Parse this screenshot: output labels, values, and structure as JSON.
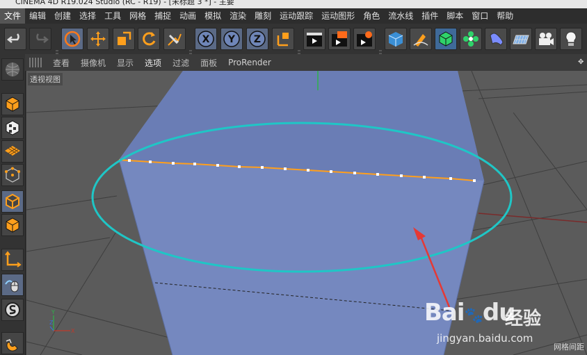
{
  "window": {
    "title": "CINEMA 4D R19.024 Studio (RC - R19) - [未标题 3 *] - 主要"
  },
  "menubar": {
    "items": [
      "文件",
      "编辑",
      "创建",
      "选择",
      "工具",
      "网格",
      "捕捉",
      "动画",
      "模拟",
      "渲染",
      "雕刻",
      "运动跟踪",
      "运动图形",
      "角色",
      "流水线",
      "插件",
      "脚本",
      "窗口",
      "帮助"
    ]
  },
  "toolbar": {
    "icons": [
      "undo-icon",
      "redo-icon",
      "live-selection-icon",
      "move-icon",
      "scale-icon",
      "rotate-icon",
      "recent-tools-icon",
      "x-axis-icon",
      "y-axis-icon",
      "z-axis-icon",
      "coordinate-system-icon",
      "render-view-icon",
      "render-picture-viewer-icon",
      "render-settings-icon",
      "cube-icon",
      "pen-icon",
      "subdivision-surface-icon",
      "cloner-icon",
      "deformer-icon",
      "floor-icon",
      "camera-icon",
      "light-icon"
    ],
    "axis_labels": {
      "x": "X",
      "y": "Y",
      "z": "Z"
    }
  },
  "viewport_menu": {
    "items": [
      "查看",
      "摄像机",
      "显示",
      "选项",
      "过滤",
      "面板",
      "ProRender"
    ]
  },
  "viewport": {
    "label": "透视视图",
    "grid_label": "网格间距",
    "axis": {
      "y": "Y",
      "z": "Z",
      "x": "X"
    }
  },
  "left_toolbar": {
    "icons": [
      "make-editable-icon",
      "model-mode-icon",
      "texture-mode-icon",
      "workplane-mode-icon",
      "points-mode-icon",
      "edges-mode-icon",
      "polygons-mode-icon",
      "axis-mode-icon",
      "tweak-mode-icon",
      "solo-icon",
      "snap-icon"
    ]
  },
  "watermark": {
    "logo": "Bai",
    "logo_suffix": "du",
    "brand": "经验",
    "url": "jingyan.baidu.com"
  },
  "colors": {
    "accent_blue": "#5b6a86",
    "cube_face": "#7a8cc6",
    "selection_edge": "#ff9f1c",
    "annotation_ellipse": "#1fc6c6",
    "annotation_arrow": "#e53935"
  }
}
